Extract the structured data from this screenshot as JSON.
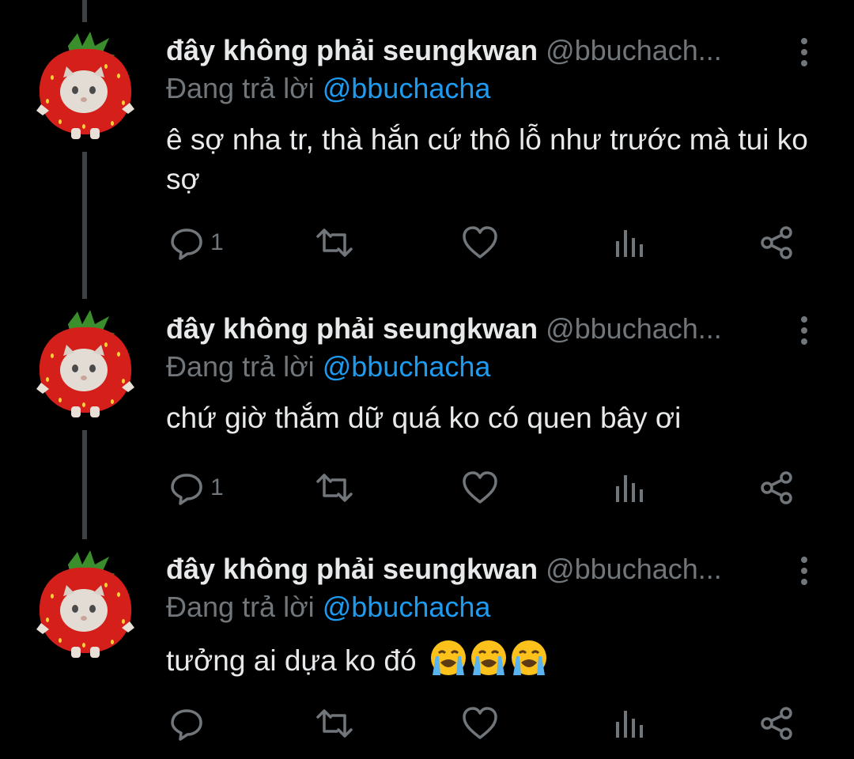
{
  "colors": {
    "background": "#000000",
    "name": "#e7e9ea",
    "muted": "#71767b",
    "mention": "#1d9bf0",
    "thread_line": "#3d4144",
    "strawberry": "#d41f1a"
  },
  "tweets": [
    {
      "name": "đây không phải seungkwan",
      "handle": "@bbuchach...",
      "reply_prefix": "Đang trả lời",
      "reply_mention": "@bbuchacha",
      "text": "ê sợ nha tr, thà hắn cứ thô lỗ như trước mà tui ko sợ",
      "reply_count": "1",
      "icons": [
        "reply-icon",
        "retweet-icon",
        "like-icon",
        "views-icon",
        "share-icon"
      ]
    },
    {
      "name": "đây không phải seungkwan",
      "handle": "@bbuchach...",
      "reply_prefix": "Đang trả lời",
      "reply_mention": "@bbuchacha",
      "text": "chứ giờ thắm dữ quá ko có quen bây ơi",
      "reply_count": "1",
      "icons": [
        "reply-icon",
        "retweet-icon",
        "like-icon",
        "views-icon",
        "share-icon"
      ]
    },
    {
      "name": "đây không phải seungkwan",
      "handle": "@bbuchach...",
      "reply_prefix": "Đang trả lời",
      "reply_mention": "@bbuchacha",
      "text": "tưởng ai dựa ko đó",
      "emojis": [
        "loudly-crying-face",
        "loudly-crying-face",
        "loudly-crying-face"
      ],
      "reply_count": "",
      "icons": [
        "reply-icon",
        "retweet-icon",
        "like-icon",
        "views-icon",
        "share-icon"
      ]
    }
  ]
}
